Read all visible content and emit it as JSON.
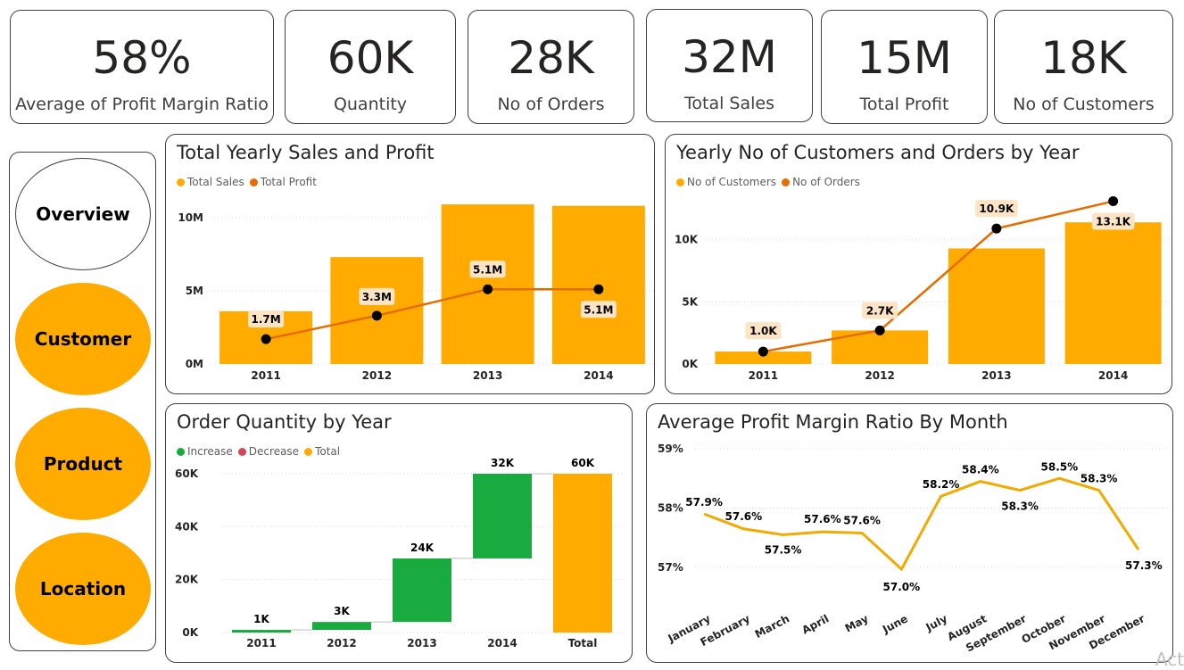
{
  "kpis": [
    {
      "value": "58%",
      "label": "Average of Profit Margin Ratio"
    },
    {
      "value": "60K",
      "label": "Quantity"
    },
    {
      "value": "28K",
      "label": "No of Orders"
    },
    {
      "value": "32M",
      "label": "Total Sales"
    },
    {
      "value": "15M",
      "label": "Total Profit"
    },
    {
      "value": "18K",
      "label": "No of Customers"
    }
  ],
  "nav": [
    {
      "label": "Overview",
      "active": false
    },
    {
      "label": "Customer",
      "active": true
    },
    {
      "label": "Product",
      "active": true
    },
    {
      "label": "Location",
      "active": true
    }
  ],
  "colors": {
    "bar": "#FFAB00",
    "line": "#E66C00",
    "increase": "#1AAB40",
    "decrease": "#D64554",
    "label_bg": "#FCE4C4"
  },
  "chart_data": [
    {
      "type": "bar+line",
      "title": "Total Yearly Sales and Profit",
      "categories": [
        "2011",
        "2012",
        "2013",
        "2014"
      ],
      "series": [
        {
          "name": "Total Sales",
          "kind": "bar",
          "values": [
            3.6,
            7.3,
            10.9,
            10.8
          ]
        },
        {
          "name": "Total Profit",
          "kind": "line",
          "values": [
            1.7,
            3.3,
            5.1,
            5.1
          ],
          "labels": [
            "1.7M",
            "3.3M",
            "5.1M",
            "5.1M"
          ]
        }
      ],
      "yticks": [
        "0M",
        "5M",
        "10M"
      ],
      "ylim": [
        0,
        12
      ],
      "unit": "M",
      "legend": "top-left"
    },
    {
      "type": "bar+line",
      "title": "Yearly No of Customers and Orders by Year",
      "categories": [
        "2011",
        "2012",
        "2013",
        "2014"
      ],
      "series": [
        {
          "name": "No of Customers",
          "kind": "bar",
          "values": [
            1.0,
            2.7,
            9.3,
            11.4
          ]
        },
        {
          "name": "No of Orders",
          "kind": "line",
          "values": [
            1.0,
            2.7,
            10.9,
            13.1
          ],
          "labels": [
            "1.0K",
            "2.7K",
            "10.9K",
            "13.1K"
          ]
        }
      ],
      "yticks": [
        "0K",
        "5K",
        "10K"
      ],
      "ylim": [
        0,
        14
      ],
      "unit": "K",
      "legend": "top-left"
    },
    {
      "type": "waterfall",
      "title": "Order Quantity by Year",
      "legend_items": [
        "Increase",
        "Decrease",
        "Total"
      ],
      "categories": [
        "2011",
        "2012",
        "2013",
        "2014",
        "Total"
      ],
      "values": [
        1,
        3,
        24,
        32
      ],
      "total": 60,
      "labels": [
        "1K",
        "3K",
        "24K",
        "32K",
        "60K"
      ],
      "yticks": [
        "0K",
        "20K",
        "40K",
        "60K"
      ],
      "ylim": [
        0,
        60
      ],
      "legend": "top-left"
    },
    {
      "type": "line",
      "title": "Average Profit Margin Ratio By Month",
      "categories": [
        "January",
        "February",
        "March",
        "April",
        "May",
        "June",
        "July",
        "August",
        "September",
        "October",
        "November",
        "December"
      ],
      "values": [
        57.9,
        57.65,
        57.55,
        57.6,
        57.58,
        56.97,
        58.2,
        58.45,
        58.3,
        58.5,
        58.3,
        57.3
      ],
      "labels": [
        "57.9%",
        "57.6%",
        "57.5%",
        "57.6%",
        "57.6%",
        "57.0%",
        "58.2%",
        "58.4%",
        "58.3%",
        "58.5%",
        "58.3%",
        "57.3%"
      ],
      "yticks": [
        "57%",
        "58%",
        "59%"
      ],
      "ylim": [
        57,
        59
      ]
    }
  ],
  "watermark": "Act"
}
